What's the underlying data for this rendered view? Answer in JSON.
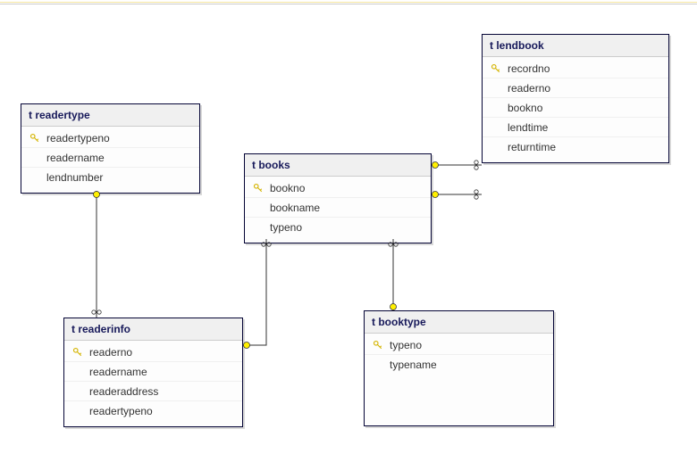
{
  "tables": {
    "readertype": {
      "title": "t readertype",
      "cols": [
        {
          "name": "readertypeno",
          "pk": true
        },
        {
          "name": "readername",
          "pk": false
        },
        {
          "name": "lendnumber",
          "pk": false
        }
      ]
    },
    "books": {
      "title": "t books",
      "cols": [
        {
          "name": "bookno",
          "pk": true
        },
        {
          "name": "bookname",
          "pk": false
        },
        {
          "name": "typeno",
          "pk": false
        }
      ]
    },
    "lendbook": {
      "title": "t lendbook",
      "cols": [
        {
          "name": "recordno",
          "pk": true
        },
        {
          "name": "readerno",
          "pk": false
        },
        {
          "name": "bookno",
          "pk": false
        },
        {
          "name": "lendtime",
          "pk": false
        },
        {
          "name": "returntime",
          "pk": false
        }
      ]
    },
    "readerinfo": {
      "title": "t readerinfo",
      "cols": [
        {
          "name": "readerno",
          "pk": true
        },
        {
          "name": "readername",
          "pk": false
        },
        {
          "name": "readeraddress",
          "pk": false
        },
        {
          "name": "readertypeno",
          "pk": false
        }
      ]
    },
    "booktype": {
      "title": "t booktype",
      "cols": [
        {
          "name": "typeno",
          "pk": true
        },
        {
          "name": "typename",
          "pk": false
        }
      ]
    }
  },
  "chart_data": {
    "type": "er-diagram",
    "entities": [
      {
        "name": "t readertype",
        "pk": [
          "readertypeno"
        ],
        "attrs": [
          "readertypeno",
          "readername",
          "lendnumber"
        ]
      },
      {
        "name": "t books",
        "pk": [
          "bookno"
        ],
        "attrs": [
          "bookno",
          "bookname",
          "typeno"
        ]
      },
      {
        "name": "t lendbook",
        "pk": [
          "recordno"
        ],
        "attrs": [
          "recordno",
          "readerno",
          "bookno",
          "lendtime",
          "returntime"
        ]
      },
      {
        "name": "t readerinfo",
        "pk": [
          "readerno"
        ],
        "attrs": [
          "readerno",
          "readername",
          "readeraddress",
          "readertypeno"
        ]
      },
      {
        "name": "t booktype",
        "pk": [
          "typeno"
        ],
        "attrs": [
          "typeno",
          "typename"
        ]
      }
    ],
    "relationships": [
      {
        "from": "t readerinfo.readertypeno",
        "to": "t readertype.readertypeno"
      },
      {
        "from": "t books.typeno",
        "to": "t booktype.typeno"
      },
      {
        "from": "t lendbook.bookno",
        "to": "t books.bookno"
      },
      {
        "from": "t lendbook.readerno",
        "to": "t readerinfo.readerno"
      }
    ]
  }
}
